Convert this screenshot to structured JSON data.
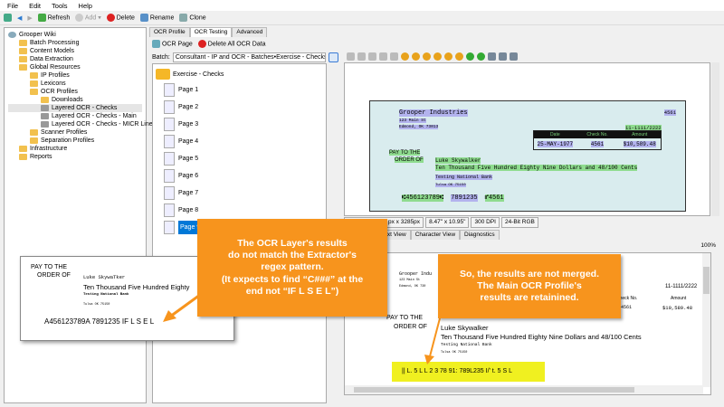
{
  "menu": [
    "File",
    "Edit",
    "Tools",
    "Help"
  ],
  "toolbar": {
    "refresh": "Refresh",
    "add": "Add",
    "delete": "Delete",
    "rename": "Rename",
    "clone": "Clone"
  },
  "tree": [
    {
      "label": "Grooper Wiki",
      "level": 0
    },
    {
      "label": "Batch Processing",
      "level": 1
    },
    {
      "label": "Content Models",
      "level": 1
    },
    {
      "label": "Data Extraction",
      "level": 1
    },
    {
      "label": "Global Resources",
      "level": 1
    },
    {
      "label": "IP Profiles",
      "level": 2
    },
    {
      "label": "Lexicons",
      "level": 2
    },
    {
      "label": "OCR Profiles",
      "level": 2
    },
    {
      "label": "Downloads",
      "level": 3
    },
    {
      "label": "Layered OCR - Checks",
      "level": 3
    },
    {
      "label": "Layered OCR - Checks - Main",
      "level": 3
    },
    {
      "label": "Layered OCR - Checks - MICR Line",
      "level": 3
    },
    {
      "label": "Scanner Profiles",
      "level": 2
    },
    {
      "label": "Separation Profiles",
      "level": 2
    },
    {
      "label": "Infrastructure",
      "level": 1
    },
    {
      "label": "Reports",
      "level": 1
    }
  ],
  "tabs": [
    "OCR Profile",
    "OCR Testing",
    "Advanced"
  ],
  "ocr_toolbar": {
    "ocr_page": "OCR Page",
    "delete_all": "Delete All OCR Data"
  },
  "batch": {
    "label": "Batch:",
    "value": "Consultant - IP and OCR - Batches•Exercise - Checks"
  },
  "batch_folder": "Exercise - Checks",
  "pages": [
    "Page 1",
    "Page 2",
    "Page 3",
    "Page 4",
    "Page 5",
    "Page 6",
    "Page 7",
    "Page 8",
    "Page 9"
  ],
  "check": {
    "company": "Grooper Industries",
    "addr1": "123 Main St",
    "addr2": "Edmond, OK 73013",
    "number": "4561",
    "routing": "11-1111/2222",
    "date_h": "Date",
    "checkno_h": "Check No.",
    "amount_h": "Amount",
    "date": "25-MAY-1977",
    "checkno": "4561",
    "amount": "$10,589.48",
    "pay1": "PAY TO THE",
    "pay2": "ORDER OF",
    "payee": "Luke Skywalker",
    "words": "Ten Thousand Five Hundred Eighty Nine Dollars and 48/100 Cents",
    "bank": "Testing National Bank",
    "bankaddr": "Tulsa OK 75150",
    "micr1": "⑆456123789⑆",
    "micr2": "7891235",
    "micr3": "⑈4561"
  },
  "status": [
    "px x 3285px",
    "8.47\" x 10.95\"",
    "300 DPI",
    "24-Bit RGB"
  ],
  "view_tabs": [
    "Text View",
    "Character View",
    "Diagnostics"
  ],
  "zoom": "100%",
  "text_view": {
    "company": "Grooper Indu",
    "addr1": "123 Main St",
    "addr2": "Edmond, OK 730",
    "routing": "11-1111/2222",
    "checkno_h": "Check No.",
    "amount_h": "Amount",
    "checkno": "4561",
    "amount": "$10,589.48",
    "pay1": "PAY TO THE",
    "pay2": "ORDER OF",
    "payee": "Luke Skywalker",
    "words": "Ten Thousand Five Hundred Eighty Nine Dollars and 48/100 Cents",
    "bank": "Testing National Bank",
    "bankaddr": "Tulsa OK 75150",
    "micr": "|| L. 5 L L 2 3 78 91: 789L235 I/' t. 5 S L"
  },
  "popup": {
    "pay1": "PAY TO THE",
    "pay2": "ORDER OF",
    "payee": "Luke SkywaTker",
    "words": "Ten Thousand Five Hundred Eighty",
    "bank": "Testing National Bank",
    "bankaddr": "Tulsa OK 75150",
    "micr": "A456123789A 7891235 IF L S E L"
  },
  "callout_left": [
    "The OCR Layer's results",
    "do not match the Extractor's",
    "regex pattern.",
    "(It expects to find “C###” at the",
    "end not “IF L S E L”)"
  ],
  "callout_right": [
    "So, the results are not merged.",
    "The Main OCR Profile's",
    "results are retainined."
  ],
  "colors": {
    "accent": "#f7941d",
    "highlight": "#f0f020",
    "selected": "#0078d7"
  }
}
